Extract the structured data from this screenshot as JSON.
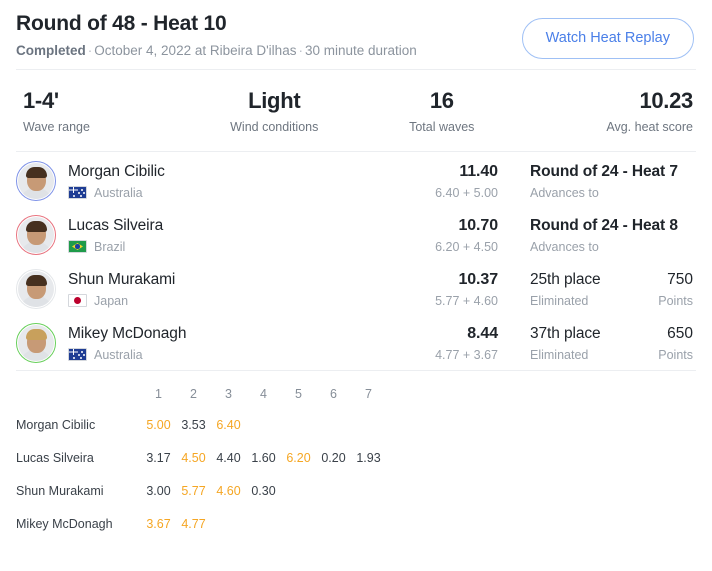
{
  "header": {
    "title": "Round of 48 - Heat 10",
    "status": "Completed",
    "date_location": "October 4, 2022 at Ribeira D'ilhas",
    "duration": "30 minute duration",
    "separator": "·",
    "replay_button": "Watch Heat Replay",
    "accent_color": "#4a7fe8"
  },
  "stats": [
    {
      "value": "1-4'",
      "label": "Wave range"
    },
    {
      "value": "Light",
      "label": "Wind conditions"
    },
    {
      "value": "16",
      "label": "Total waves"
    },
    {
      "value": "10.23",
      "label": "Avg. heat score"
    }
  ],
  "athletes": [
    {
      "name": "Morgan Cibilic",
      "country": "Australia",
      "flag": "au",
      "ring_color": "#7f93e8",
      "total": "11.40",
      "breakdown": "6.40 + 5.00",
      "result": "Round of 24 - Heat 7",
      "result_sub": "Advances to",
      "result_bold": true,
      "points": "",
      "points_label": ""
    },
    {
      "name": "Lucas Silveira",
      "country": "Brazil",
      "flag": "br",
      "ring_color": "#e8737f",
      "total": "10.70",
      "breakdown": "6.20 + 4.50",
      "result": "Round of 24 - Heat 8",
      "result_sub": "Advances to",
      "result_bold": true,
      "points": "",
      "points_label": ""
    },
    {
      "name": "Shun Murakami",
      "country": "Japan",
      "flag": "jp",
      "ring_color": "#e4e7ea",
      "total": "10.37",
      "breakdown": "5.77 + 4.60",
      "result": "25th place",
      "result_sub": "Eliminated",
      "result_bold": false,
      "points": "750",
      "points_label": "Points"
    },
    {
      "name": "Mikey McDonagh",
      "country": "Australia",
      "flag": "au",
      "ring_color": "#67cf5a",
      "total": "8.44",
      "breakdown": "4.77 + 3.67",
      "result": "37th place",
      "result_sub": "Eliminated",
      "result_bold": false,
      "points": "650",
      "points_label": "Points"
    }
  ],
  "wave_table": {
    "columns": [
      "1",
      "2",
      "3",
      "4",
      "5",
      "6",
      "7"
    ],
    "highlight_color": "#f5a623",
    "rows": [
      {
        "athlete": "Morgan Cibilic",
        "scores": [
          "5.00",
          "3.53",
          "6.40",
          "",
          "",
          "",
          ""
        ],
        "counted": [
          true,
          false,
          true,
          false,
          false,
          false,
          false
        ]
      },
      {
        "athlete": "Lucas Silveira",
        "scores": [
          "3.17",
          "4.50",
          "4.40",
          "1.60",
          "6.20",
          "0.20",
          "1.93"
        ],
        "counted": [
          false,
          true,
          false,
          false,
          true,
          false,
          false
        ]
      },
      {
        "athlete": "Shun Murakami",
        "scores": [
          "3.00",
          "5.77",
          "4.60",
          "0.30",
          "",
          "",
          ""
        ],
        "counted": [
          false,
          true,
          true,
          false,
          false,
          false,
          false
        ]
      },
      {
        "athlete": "Mikey McDonagh",
        "scores": [
          "3.67",
          "4.77",
          "",
          "",
          "",
          "",
          ""
        ],
        "counted": [
          true,
          true,
          false,
          false,
          false,
          false,
          false
        ]
      }
    ]
  }
}
